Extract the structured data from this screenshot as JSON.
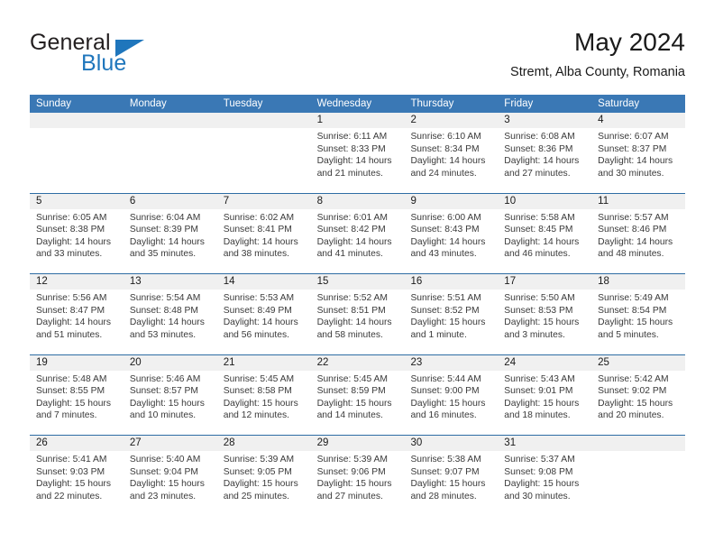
{
  "brand": {
    "word_one": "General",
    "word_two": "Blue",
    "triangle_icon": "triangle-icon"
  },
  "header": {
    "title": "May 2024",
    "subtitle": "Stremt, Alba County, Romania"
  },
  "colors": {
    "header_blue": "#3a78b5",
    "row_divider_blue": "#2e6da4",
    "daynum_band": "#f0f0f0",
    "brand_blue": "#1f76bc"
  },
  "calendar": {
    "weekday_headers": [
      "Sunday",
      "Monday",
      "Tuesday",
      "Wednesday",
      "Thursday",
      "Friday",
      "Saturday"
    ],
    "weeks": [
      [
        {
          "day": "",
          "lines": []
        },
        {
          "day": "",
          "lines": []
        },
        {
          "day": "",
          "lines": []
        },
        {
          "day": "1",
          "lines": [
            "Sunrise: 6:11 AM",
            "Sunset: 8:33 PM",
            "Daylight: 14 hours",
            "and 21 minutes."
          ]
        },
        {
          "day": "2",
          "lines": [
            "Sunrise: 6:10 AM",
            "Sunset: 8:34 PM",
            "Daylight: 14 hours",
            "and 24 minutes."
          ]
        },
        {
          "day": "3",
          "lines": [
            "Sunrise: 6:08 AM",
            "Sunset: 8:36 PM",
            "Daylight: 14 hours",
            "and 27 minutes."
          ]
        },
        {
          "day": "4",
          "lines": [
            "Sunrise: 6:07 AM",
            "Sunset: 8:37 PM",
            "Daylight: 14 hours",
            "and 30 minutes."
          ]
        }
      ],
      [
        {
          "day": "5",
          "lines": [
            "Sunrise: 6:05 AM",
            "Sunset: 8:38 PM",
            "Daylight: 14 hours",
            "and 33 minutes."
          ]
        },
        {
          "day": "6",
          "lines": [
            "Sunrise: 6:04 AM",
            "Sunset: 8:39 PM",
            "Daylight: 14 hours",
            "and 35 minutes."
          ]
        },
        {
          "day": "7",
          "lines": [
            "Sunrise: 6:02 AM",
            "Sunset: 8:41 PM",
            "Daylight: 14 hours",
            "and 38 minutes."
          ]
        },
        {
          "day": "8",
          "lines": [
            "Sunrise: 6:01 AM",
            "Sunset: 8:42 PM",
            "Daylight: 14 hours",
            "and 41 minutes."
          ]
        },
        {
          "day": "9",
          "lines": [
            "Sunrise: 6:00 AM",
            "Sunset: 8:43 PM",
            "Daylight: 14 hours",
            "and 43 minutes."
          ]
        },
        {
          "day": "10",
          "lines": [
            "Sunrise: 5:58 AM",
            "Sunset: 8:45 PM",
            "Daylight: 14 hours",
            "and 46 minutes."
          ]
        },
        {
          "day": "11",
          "lines": [
            "Sunrise: 5:57 AM",
            "Sunset: 8:46 PM",
            "Daylight: 14 hours",
            "and 48 minutes."
          ]
        }
      ],
      [
        {
          "day": "12",
          "lines": [
            "Sunrise: 5:56 AM",
            "Sunset: 8:47 PM",
            "Daylight: 14 hours",
            "and 51 minutes."
          ]
        },
        {
          "day": "13",
          "lines": [
            "Sunrise: 5:54 AM",
            "Sunset: 8:48 PM",
            "Daylight: 14 hours",
            "and 53 minutes."
          ]
        },
        {
          "day": "14",
          "lines": [
            "Sunrise: 5:53 AM",
            "Sunset: 8:49 PM",
            "Daylight: 14 hours",
            "and 56 minutes."
          ]
        },
        {
          "day": "15",
          "lines": [
            "Sunrise: 5:52 AM",
            "Sunset: 8:51 PM",
            "Daylight: 14 hours",
            "and 58 minutes."
          ]
        },
        {
          "day": "16",
          "lines": [
            "Sunrise: 5:51 AM",
            "Sunset: 8:52 PM",
            "Daylight: 15 hours",
            "and 1 minute."
          ]
        },
        {
          "day": "17",
          "lines": [
            "Sunrise: 5:50 AM",
            "Sunset: 8:53 PM",
            "Daylight: 15 hours",
            "and 3 minutes."
          ]
        },
        {
          "day": "18",
          "lines": [
            "Sunrise: 5:49 AM",
            "Sunset: 8:54 PM",
            "Daylight: 15 hours",
            "and 5 minutes."
          ]
        }
      ],
      [
        {
          "day": "19",
          "lines": [
            "Sunrise: 5:48 AM",
            "Sunset: 8:55 PM",
            "Daylight: 15 hours",
            "and 7 minutes."
          ]
        },
        {
          "day": "20",
          "lines": [
            "Sunrise: 5:46 AM",
            "Sunset: 8:57 PM",
            "Daylight: 15 hours",
            "and 10 minutes."
          ]
        },
        {
          "day": "21",
          "lines": [
            "Sunrise: 5:45 AM",
            "Sunset: 8:58 PM",
            "Daylight: 15 hours",
            "and 12 minutes."
          ]
        },
        {
          "day": "22",
          "lines": [
            "Sunrise: 5:45 AM",
            "Sunset: 8:59 PM",
            "Daylight: 15 hours",
            "and 14 minutes."
          ]
        },
        {
          "day": "23",
          "lines": [
            "Sunrise: 5:44 AM",
            "Sunset: 9:00 PM",
            "Daylight: 15 hours",
            "and 16 minutes."
          ]
        },
        {
          "day": "24",
          "lines": [
            "Sunrise: 5:43 AM",
            "Sunset: 9:01 PM",
            "Daylight: 15 hours",
            "and 18 minutes."
          ]
        },
        {
          "day": "25",
          "lines": [
            "Sunrise: 5:42 AM",
            "Sunset: 9:02 PM",
            "Daylight: 15 hours",
            "and 20 minutes."
          ]
        }
      ],
      [
        {
          "day": "26",
          "lines": [
            "Sunrise: 5:41 AM",
            "Sunset: 9:03 PM",
            "Daylight: 15 hours",
            "and 22 minutes."
          ]
        },
        {
          "day": "27",
          "lines": [
            "Sunrise: 5:40 AM",
            "Sunset: 9:04 PM",
            "Daylight: 15 hours",
            "and 23 minutes."
          ]
        },
        {
          "day": "28",
          "lines": [
            "Sunrise: 5:39 AM",
            "Sunset: 9:05 PM",
            "Daylight: 15 hours",
            "and 25 minutes."
          ]
        },
        {
          "day": "29",
          "lines": [
            "Sunrise: 5:39 AM",
            "Sunset: 9:06 PM",
            "Daylight: 15 hours",
            "and 27 minutes."
          ]
        },
        {
          "day": "30",
          "lines": [
            "Sunrise: 5:38 AM",
            "Sunset: 9:07 PM",
            "Daylight: 15 hours",
            "and 28 minutes."
          ]
        },
        {
          "day": "31",
          "lines": [
            "Sunrise: 5:37 AM",
            "Sunset: 9:08 PM",
            "Daylight: 15 hours",
            "and 30 minutes."
          ]
        },
        {
          "day": "",
          "lines": []
        }
      ]
    ]
  }
}
